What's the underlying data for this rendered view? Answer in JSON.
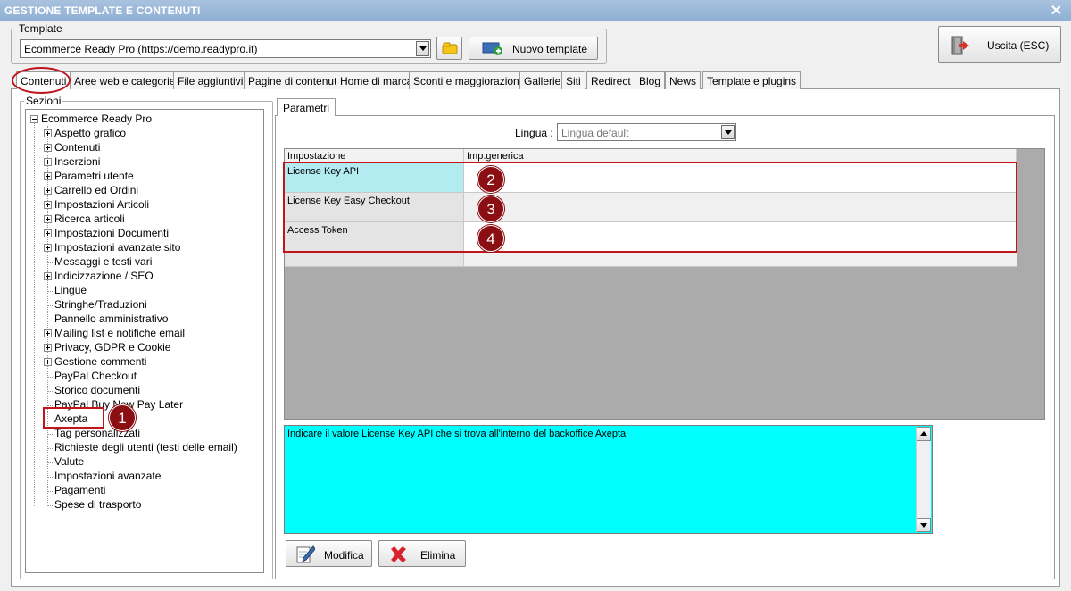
{
  "window": {
    "title": "GESTIONE TEMPLATE E CONTENUTI",
    "close_glyph": "✕"
  },
  "template_group": {
    "legend": "Template",
    "selected": "Ecommerce Ready Pro (https://demo.readypro.it)",
    "new_button": "Nuovo template"
  },
  "exit_button": "Uscita (ESC)",
  "tabs": [
    "Contenuti",
    "Aree web e categorie",
    "File aggiuntivi",
    "Pagine di contenuti",
    "Home di marca",
    "Sconti e maggiorazioni",
    "Gallerie",
    "Siti",
    "Redirect",
    "Blog",
    "News",
    "Template e plugins"
  ],
  "sections": {
    "legend": "Sezioni",
    "root": "Ecommerce Ready Pro",
    "items": [
      {
        "label": "Aspetto grafico",
        "expandable": true
      },
      {
        "label": "Contenuti",
        "expandable": true
      },
      {
        "label": "Inserzioni",
        "expandable": true
      },
      {
        "label": "Parametri utente",
        "expandable": true
      },
      {
        "label": "Carrello ed Ordini",
        "expandable": true
      },
      {
        "label": "Impostazioni Articoli",
        "expandable": true
      },
      {
        "label": "Ricerca articoli",
        "expandable": true
      },
      {
        "label": "Impostazioni Documenti",
        "expandable": true
      },
      {
        "label": "Impostazioni avanzate sito",
        "expandable": true
      },
      {
        "label": "Messaggi e testi vari",
        "expandable": false
      },
      {
        "label": "Indicizzazione / SEO",
        "expandable": true
      },
      {
        "label": "Lingue",
        "expandable": false
      },
      {
        "label": "Stringhe/Traduzioni",
        "expandable": false
      },
      {
        "label": "Pannello amministrativo",
        "expandable": false
      },
      {
        "label": "Mailing list e notifiche email",
        "expandable": true
      },
      {
        "label": "Privacy, GDPR e Cookie",
        "expandable": true
      },
      {
        "label": "Gestione commenti",
        "expandable": true
      },
      {
        "label": "PayPal Checkout",
        "expandable": false
      },
      {
        "label": "Storico documenti",
        "expandable": false
      },
      {
        "label": "PayPal Buy Now Pay Later",
        "expandable": false
      },
      {
        "label": "Axepta",
        "expandable": false
      },
      {
        "label": "Tag personalizzati",
        "expandable": false
      },
      {
        "label": "Richieste degli utenti (testi delle email)",
        "expandable": false
      },
      {
        "label": "Valute",
        "expandable": false
      },
      {
        "label": "Impostazioni avanzate",
        "expandable": false
      },
      {
        "label": "Pagamenti",
        "expandable": false
      },
      {
        "label": "Spese di trasporto",
        "expandable": false
      }
    ]
  },
  "params": {
    "tab": "Parametri",
    "language_label": "Lingua :",
    "language_value": "Lingua default",
    "columns": [
      "Impostazione",
      "Imp.generica"
    ],
    "rows": [
      {
        "key": "License Key API",
        "value": ""
      },
      {
        "key": "License Key Easy Checkout",
        "value": ""
      },
      {
        "key": "Access Token",
        "value": ""
      }
    ],
    "description": "Indicare il valore License Key API che si trova all'interno del backoffice Axepta"
  },
  "actions": {
    "edit": "Modifica",
    "delete": "Elimina"
  },
  "annotations": [
    "1",
    "2",
    "3",
    "4"
  ],
  "colors": {
    "accent_red": "#c0151c",
    "badge": "#8a0e12",
    "selected_key": "#b2ebf0",
    "description_bg": "#00ffff"
  }
}
